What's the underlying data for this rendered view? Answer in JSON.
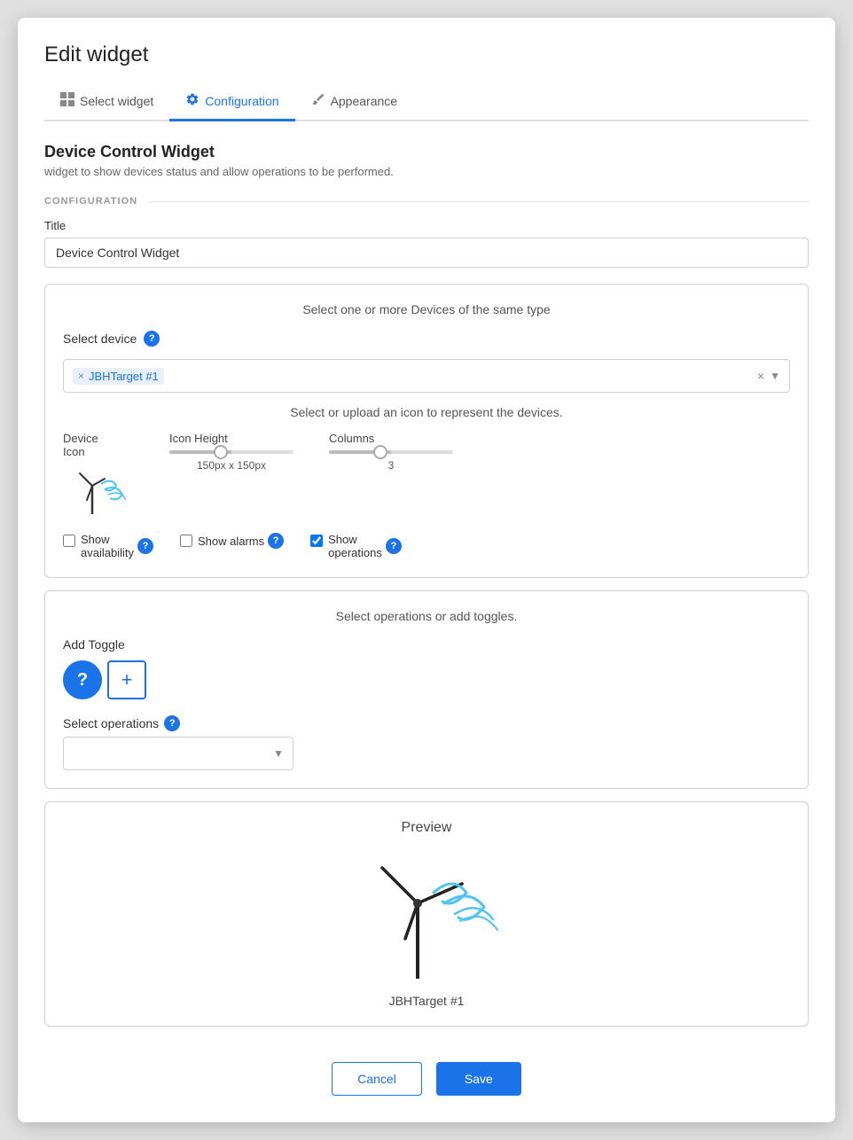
{
  "modal": {
    "title": "Edit widget"
  },
  "tabs": [
    {
      "id": "select-widget",
      "label": "Select widget",
      "icon": "grid",
      "active": false
    },
    {
      "id": "configuration",
      "label": "Configuration",
      "icon": "settings",
      "active": true
    },
    {
      "id": "appearance",
      "label": "Appearance",
      "icon": "brush",
      "active": false
    }
  ],
  "widget": {
    "name": "Device Control Widget",
    "description": "widget to show devices status and allow operations to be performed."
  },
  "configuration": {
    "section_label": "CONFIGURATION",
    "title_label": "Title",
    "title_value": "Device Control Widget"
  },
  "device_select": {
    "header": "Select one or more Devices of the same type",
    "label": "Select device",
    "selected_device": "JBHTarget #1"
  },
  "icon_section": {
    "header": "Select or upload an icon to represent the devices.",
    "device_icon_label": "Device\nIcon",
    "icon_height_label": "Icon Height",
    "icon_height_value": "150px x 150px",
    "columns_label": "Columns",
    "columns_value": "3"
  },
  "checkboxes": {
    "show_availability": {
      "label": "Show\navailability",
      "checked": false
    },
    "show_alarms": {
      "label": "Show alarms",
      "checked": false
    },
    "show_operations": {
      "label": "Show\noperations",
      "checked": true
    }
  },
  "operations": {
    "header": "Select operations or add toggles.",
    "add_toggle_label": "Add Toggle",
    "select_ops_label": "Select operations"
  },
  "preview": {
    "header": "Preview",
    "device_name": "JBHTarget #1"
  },
  "footer": {
    "cancel_label": "Cancel",
    "save_label": "Save"
  }
}
